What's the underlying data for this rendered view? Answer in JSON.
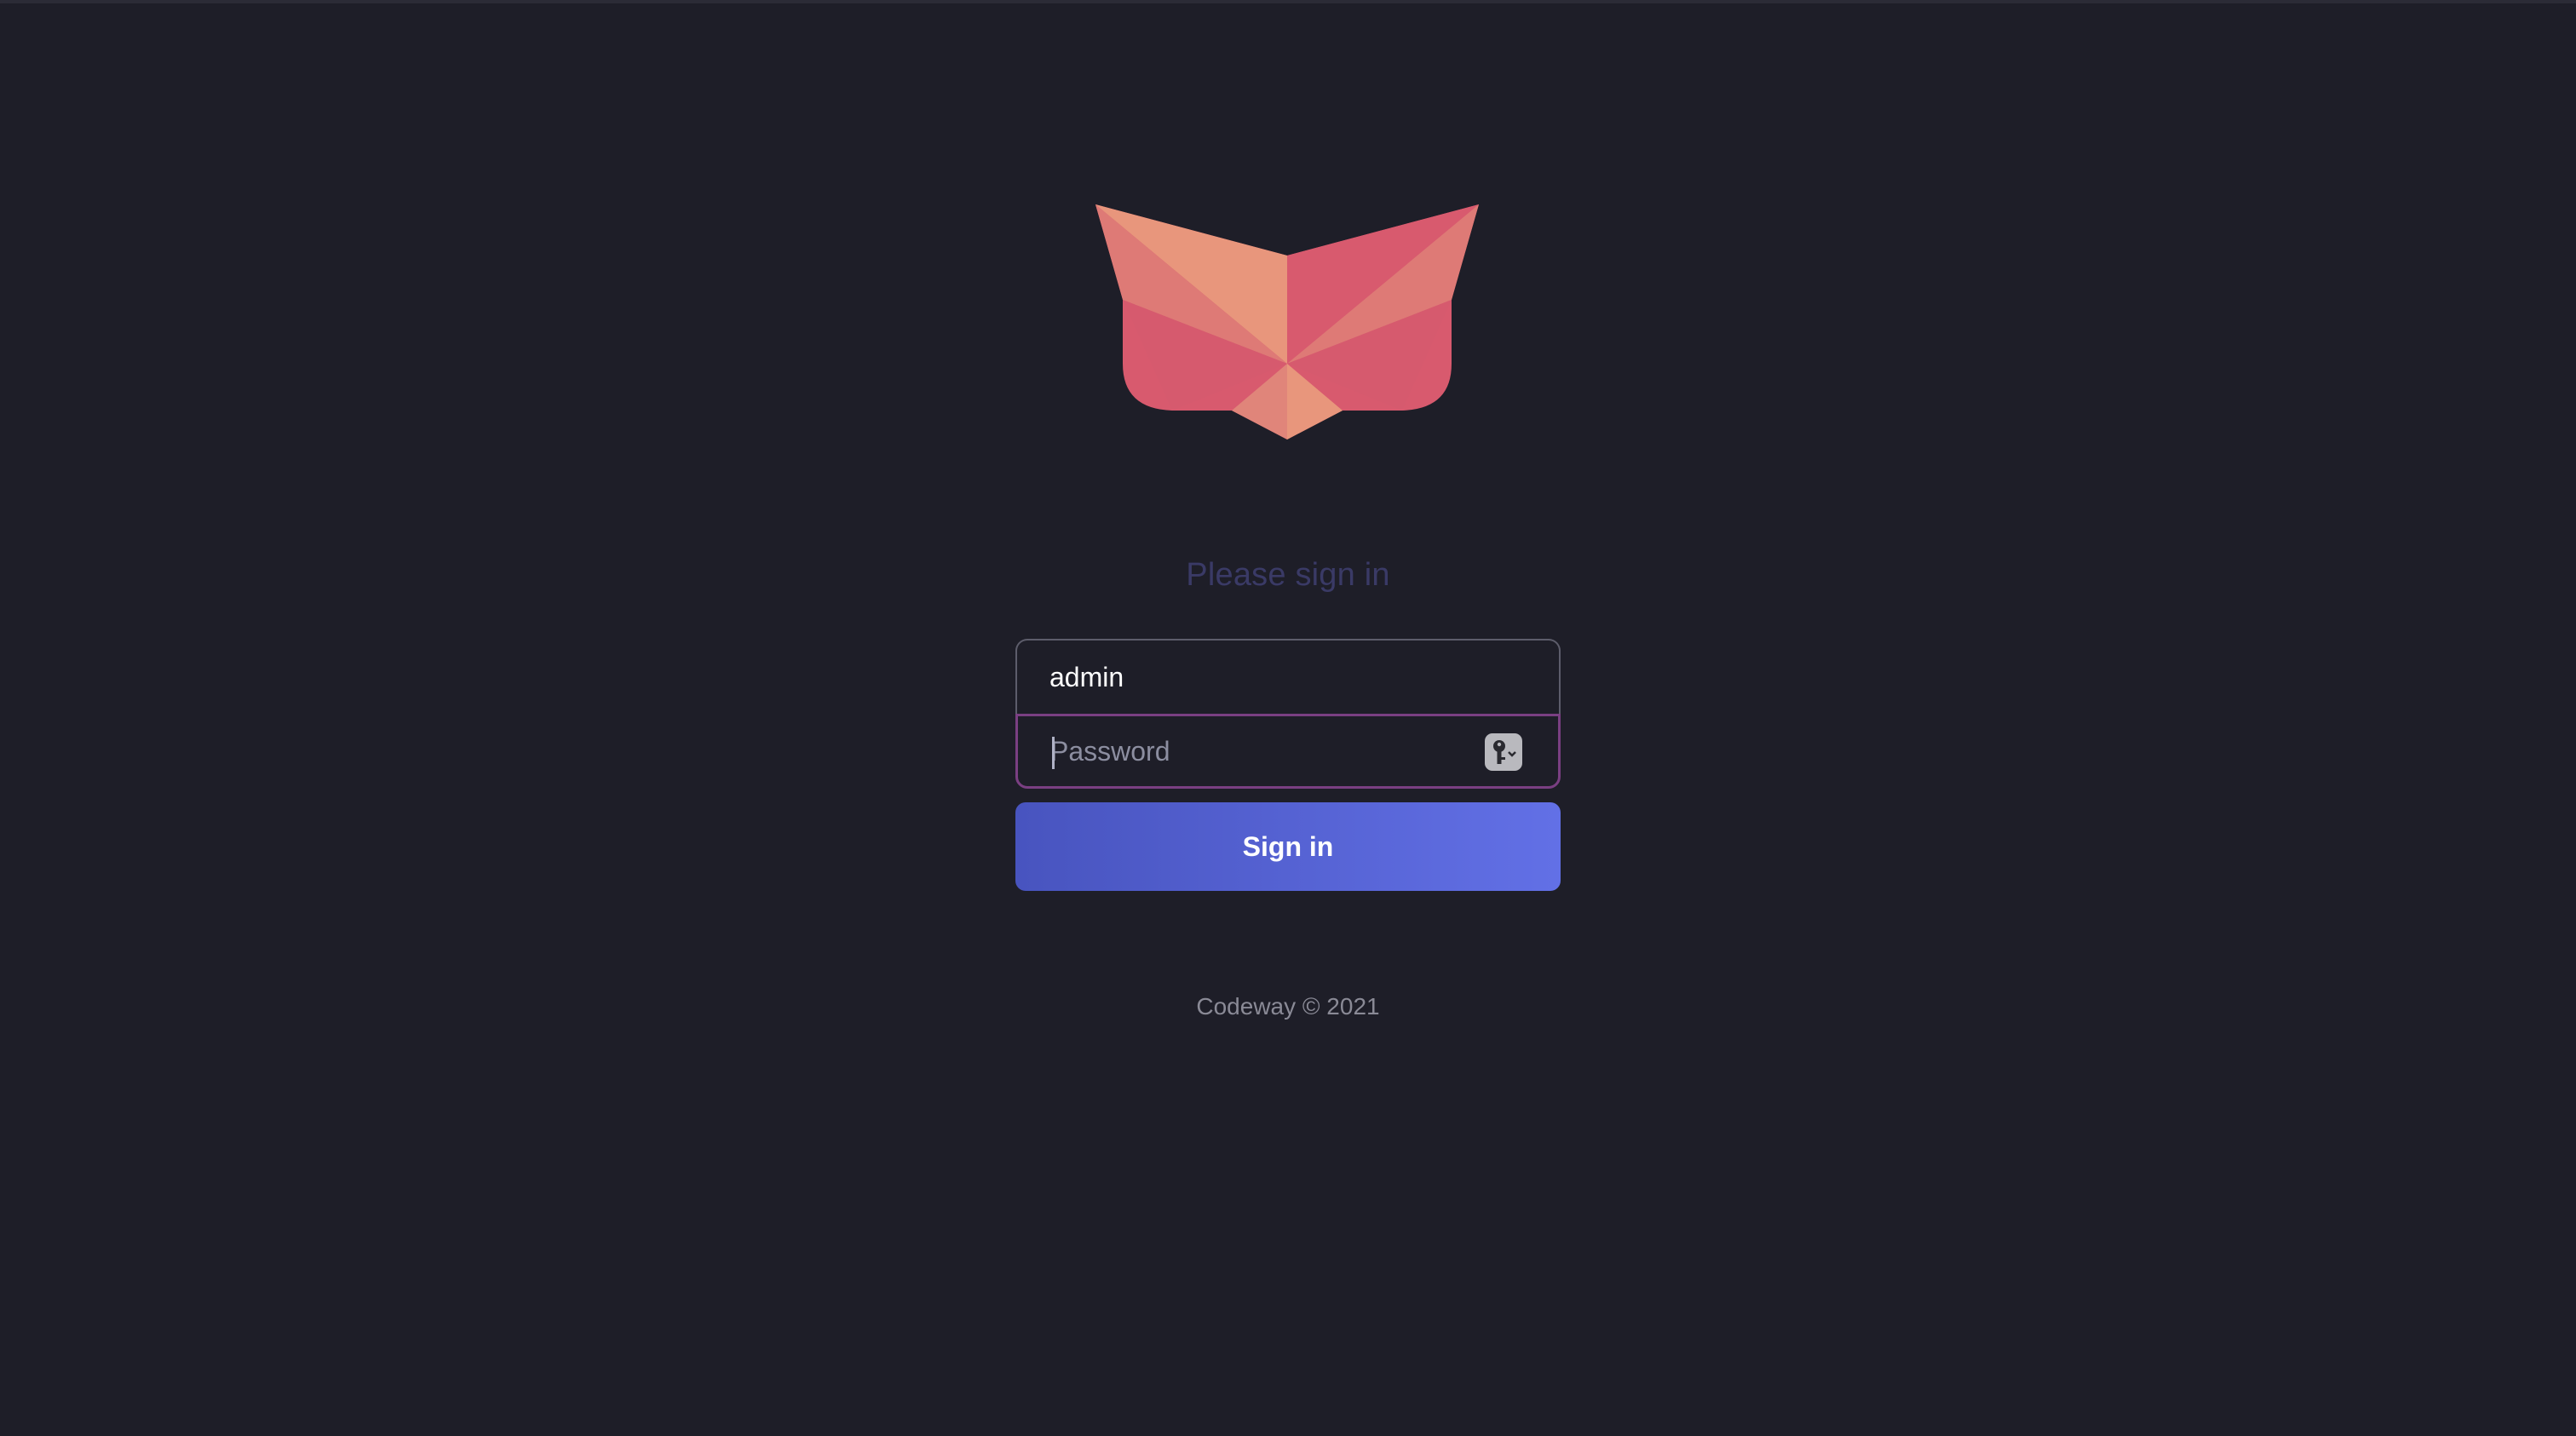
{
  "logo": {
    "icon": "fox-logo-icon",
    "colors": {
      "light": "#e8967c",
      "mid": "#de7a76",
      "dark": "#d85a6e"
    }
  },
  "heading": "Please sign in",
  "form": {
    "username_value": "admin",
    "password_placeholder": "Password",
    "password_value": "",
    "key_icon": "key-icon",
    "submit_label": "Sign in"
  },
  "footer": "Codeway © 2021",
  "colors": {
    "background": "#1e1e28",
    "accent_start": "#4854bf",
    "accent_end": "#6270e6",
    "focus_border": "#7a3f82"
  }
}
